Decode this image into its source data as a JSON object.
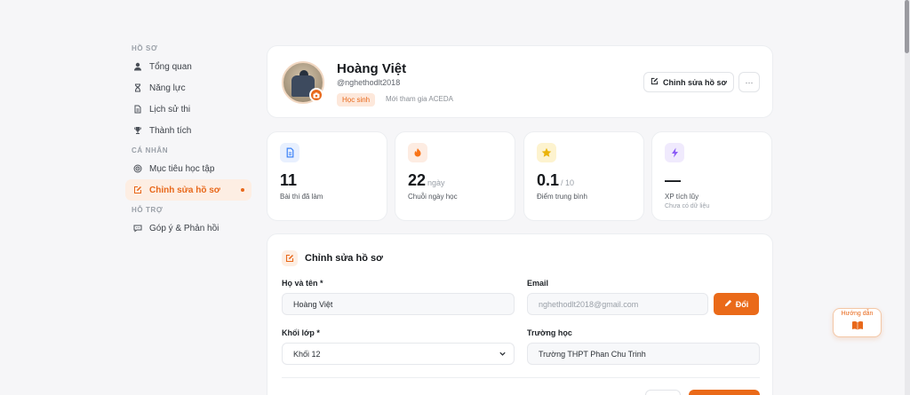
{
  "sidebar": {
    "sections": [
      {
        "title": "HỒ SƠ",
        "items": [
          {
            "label": "Tổng quan",
            "icon": "user-icon"
          },
          {
            "label": "Năng lực",
            "icon": "hourglass-icon"
          },
          {
            "label": "Lịch sử thi",
            "icon": "document-icon"
          },
          {
            "label": "Thành tích",
            "icon": "trophy-icon"
          }
        ]
      },
      {
        "title": "CÁ NHÂN",
        "items": [
          {
            "label": "Mục tiêu học tập",
            "icon": "target-icon"
          },
          {
            "label": "Chỉnh sửa hồ sơ",
            "icon": "edit-icon",
            "active": true
          }
        ]
      },
      {
        "title": "HỖ TRỢ",
        "items": [
          {
            "label": "Góp ý & Phản hồi",
            "icon": "chat-icon"
          }
        ]
      }
    ]
  },
  "profile": {
    "name": "Hoàng Việt",
    "handle": "@nghethodlt2018",
    "role": "Học sinh",
    "joined": "Mới tham gia ACEDA",
    "edit_label": "Chỉnh sửa hồ sơ",
    "more_label": "···"
  },
  "stats": [
    {
      "value": "11",
      "unit": "",
      "label": "Bài thi đã làm",
      "sub": "",
      "icon": "document-icon",
      "color": "#3b82f6",
      "bg": "#e8f0fe"
    },
    {
      "value": "22",
      "unit": "ngày",
      "label": "Chuỗi ngày học",
      "sub": "",
      "icon": "fire-icon",
      "color": "#f97316",
      "bg": "#fdece2"
    },
    {
      "value": "0.1",
      "unit": "/ 10",
      "label": "Điểm trung bình",
      "sub": "",
      "icon": "star-icon",
      "color": "#eab308",
      "bg": "#fdf3cf"
    },
    {
      "value": "—",
      "unit": "",
      "label": "XP tích lũy",
      "sub": "Chưa có dữ liệu",
      "icon": "bolt-icon",
      "color": "#8b5cf6",
      "bg": "#f0eafd"
    }
  ],
  "form": {
    "title": "Chỉnh sửa hồ sơ",
    "fullname_label": "Họ và tên *",
    "fullname_value": "Hoàng Việt",
    "email_label": "Email",
    "email_placeholder": "nghethodlt2018@gmail.com",
    "change_label": "Đổi",
    "grade_label": "Khối lớp *",
    "grade_value": "Khối 12",
    "school_label": "Trường học",
    "school_value": "Trường THPT Phan Chu Trinh"
  },
  "guide": {
    "label": "Hướng dẫn",
    "icon": "book-icon"
  },
  "colors": {
    "accent": "#e8681a"
  }
}
